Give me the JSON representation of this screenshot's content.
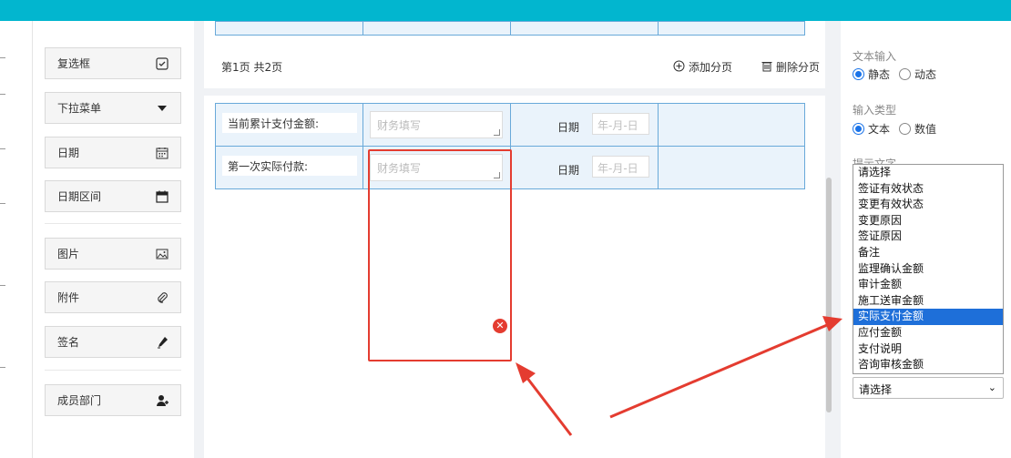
{
  "palette": {
    "items": [
      {
        "label": "复选框",
        "icon": "checkbox-icon"
      },
      {
        "label": "下拉菜单",
        "icon": "caret-down-icon"
      },
      {
        "label": "日期",
        "icon": "calendar-icon"
      },
      {
        "label": "日期区间",
        "icon": "calendar-range-icon"
      },
      {
        "label": "图片",
        "icon": "image-icon"
      },
      {
        "label": "附件",
        "icon": "paperclip-icon"
      },
      {
        "label": "签名",
        "icon": "pen-icon"
      },
      {
        "label": "成员部门",
        "icon": "add-user-icon"
      }
    ]
  },
  "pager": {
    "text": "第1页 共2页",
    "add": "添加分页",
    "delete": "删除分页"
  },
  "table": {
    "rows": [
      {
        "label": "当前累计支付金额:",
        "placeholder": "财务填写",
        "date_label": "日期",
        "date_placeholder": "年-月-日"
      },
      {
        "label": "第一次实际付款:",
        "placeholder": "财务填写",
        "date_label": "日期",
        "date_placeholder": "年-月-日"
      }
    ]
  },
  "right_panel": {
    "text_input_label": "文本输入",
    "text_input_options": [
      "静态",
      "动态"
    ],
    "input_type_label": "输入类型",
    "input_type_options": [
      "文本",
      "数值"
    ],
    "hint_label": "提示文字",
    "dropdown_options": [
      "请选择",
      "签证有效状态",
      "变更有效状态",
      "变更原因",
      "签证原因",
      "备注",
      "监理确认金额",
      "审计金额",
      "施工送审金额",
      "实际支付金额",
      "应付金额",
      "支付说明",
      "咨询审核金额"
    ],
    "dropdown_selected_index": 9,
    "select_value": "请选择"
  },
  "colors": {
    "topbar": "#02b6cf",
    "cell_border": "#69a9d9",
    "highlight": "#e43c30",
    "select_blue": "#1e6fd9"
  },
  "_note": "Abridged: 4 of 6 table row entries not reproduced."
}
